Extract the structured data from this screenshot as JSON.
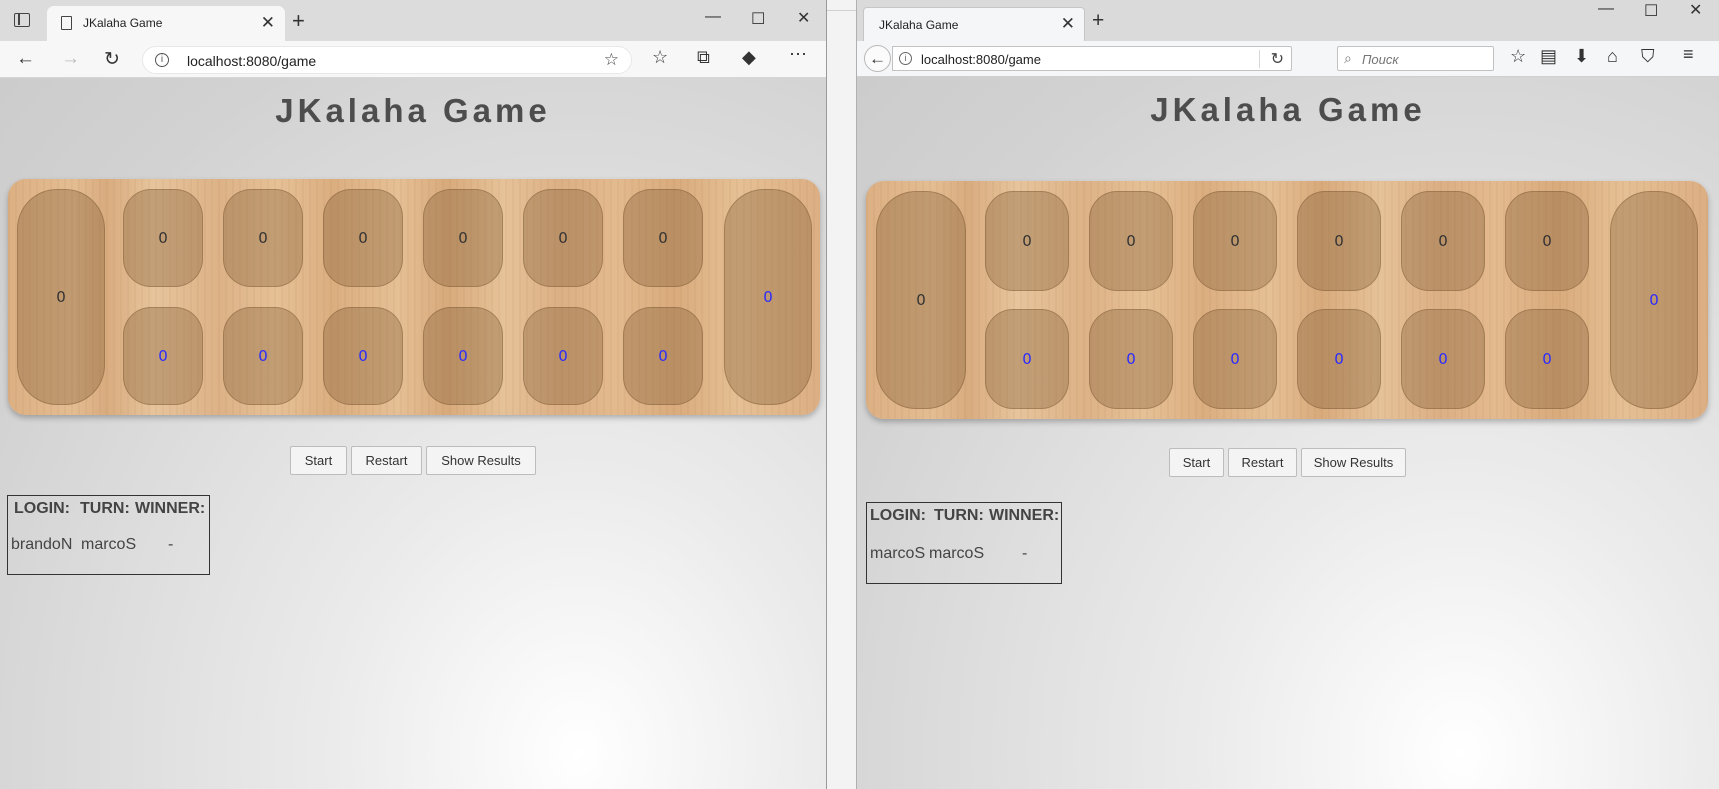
{
  "left_browser": {
    "tab_title": "JKalaha Game",
    "url": "localhost:8080/game",
    "page": {
      "title": "JKalaha Game",
      "board": {
        "left_store": "0",
        "top_row": [
          "0",
          "0",
          "0",
          "0",
          "0",
          "0"
        ],
        "bottom_row": [
          "0",
          "0",
          "0",
          "0",
          "0",
          "0"
        ],
        "right_store": "0"
      },
      "buttons": {
        "start": "Start",
        "restart": "Restart",
        "show_results": "Show Results"
      },
      "table": {
        "headers": [
          "LOGIN:",
          "TURN:",
          "WINNER:"
        ],
        "login": "brandoN",
        "turn": "marcoS",
        "winner": "-"
      }
    }
  },
  "right_browser": {
    "tab_title": "JKalaha Game",
    "url": "localhost:8080/game",
    "search_placeholder": "Поиск",
    "page": {
      "title": "JKalaha Game",
      "board": {
        "left_store": "0",
        "top_row": [
          "0",
          "0",
          "0",
          "0",
          "0",
          "0"
        ],
        "bottom_row": [
          "0",
          "0",
          "0",
          "0",
          "0",
          "0"
        ],
        "right_store": "0"
      },
      "buttons": {
        "start": "Start",
        "restart": "Restart",
        "show_results": "Show Results"
      },
      "table": {
        "headers": [
          "LOGIN:",
          "TURN:",
          "WINNER:"
        ],
        "login": "marcoS",
        "turn": "marcoS",
        "winner": "-"
      }
    }
  },
  "colors": {
    "title": "#4d4d4d",
    "pit_number_player": "#2b2bff",
    "pit_number_opponent": "#333333"
  }
}
